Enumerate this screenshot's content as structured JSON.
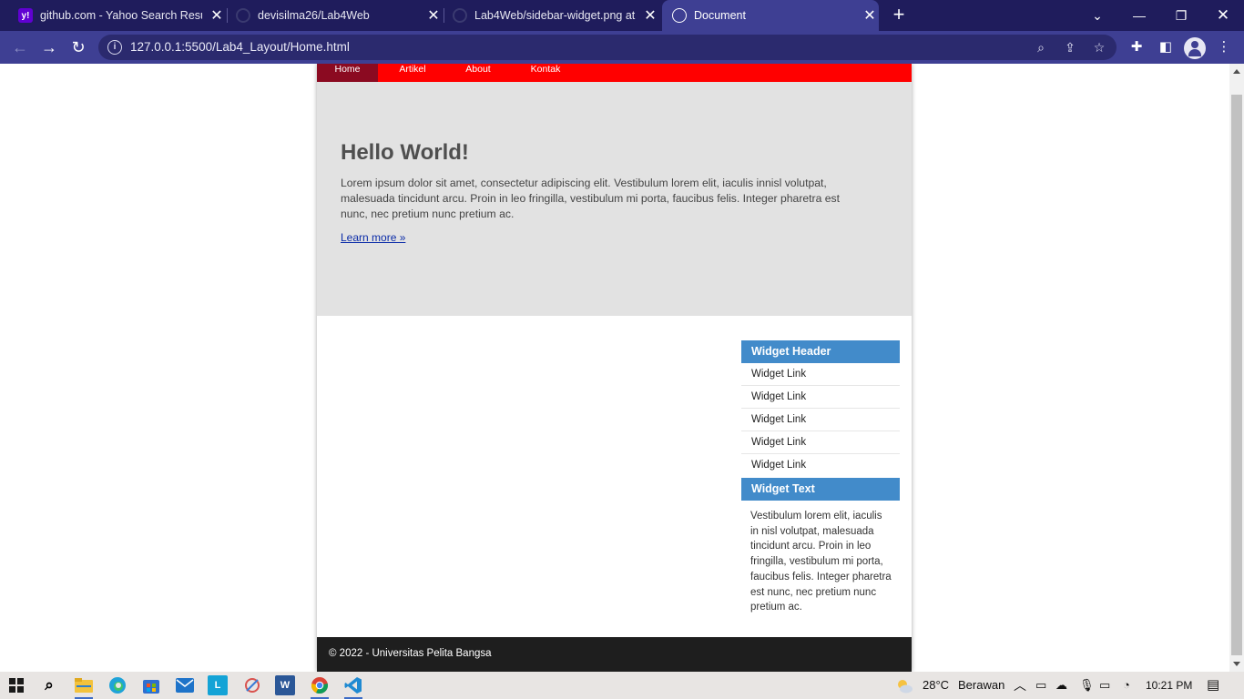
{
  "browser": {
    "tabs": [
      {
        "title": "github.com - Yahoo Search Resul",
        "favicon": "yahoo-icon",
        "active": false
      },
      {
        "title": "devisilma26/Lab4Web",
        "favicon": "github-icon",
        "active": false
      },
      {
        "title": "Lab4Web/sidebar-widget.png at",
        "favicon": "github-icon",
        "active": false
      },
      {
        "title": "Document",
        "favicon": "globe-icon",
        "active": true
      }
    ],
    "url": "127.0.0.1:5500/Lab4_Layout/Home.html"
  },
  "page": {
    "nav": [
      "Home",
      "Artikel",
      "About",
      "Kontak"
    ],
    "hero": {
      "title": "Hello World!",
      "text": "Lorem ipsum dolor sit amet, consectetur adipiscing elit. Vestibulum lorem elit, iaculis innisl volutpat, malesuada tincidunt arcu. Proin in leo fringilla, vestibulum mi porta, faucibus felis. Integer pharetra est nunc, nec pretium nunc pretium ac.",
      "link": "Learn more »"
    },
    "sidebar": {
      "widget_header": "Widget Header",
      "links": [
        "Widget Link",
        "Widget Link",
        "Widget Link",
        "Widget Link",
        "Widget Link"
      ],
      "widget_text_header": "Widget Text",
      "widget_text": "Vestibulum lorem elit, iaculis in nisl volutpat, malesuada tincidunt arcu. Proin in leo fringilla, vestibulum mi porta, faucibus felis. Integer pharetra est nunc, nec pretium nunc pretium ac."
    },
    "footer": "© 2022 - Universitas Pelita Bangsa"
  },
  "taskbar": {
    "weather_temp": "28°C",
    "weather_text": "Berawan",
    "time": "10:21 PM"
  },
  "colors": {
    "nav_bg": "#ff0000",
    "nav_active": "#8b0a21",
    "widget_header": "#428bca",
    "footer_bg": "#1e1e1e",
    "hero_bg": "#e2e2e2"
  }
}
